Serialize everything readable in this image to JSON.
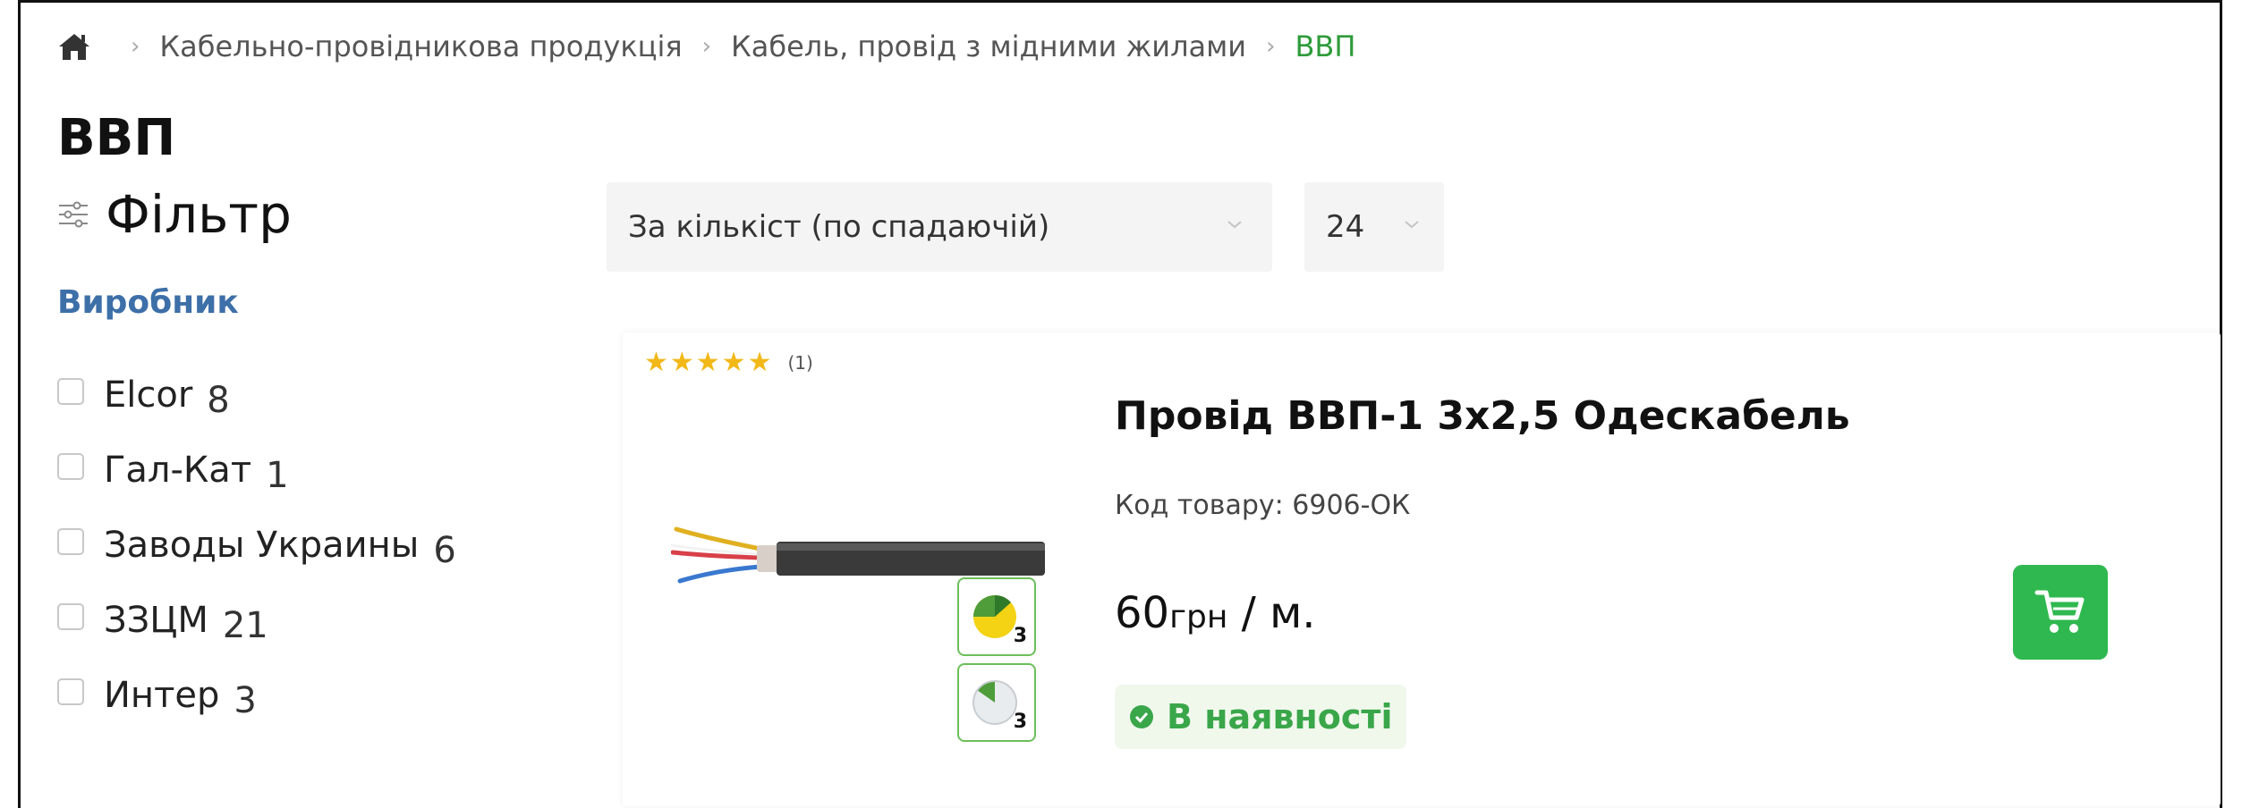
{
  "breadcrumb": {
    "items": [
      "Кабельно-провідникова продукція",
      "Кабель, провід з мідними жилами"
    ],
    "current": "ВВП",
    "separator": "›"
  },
  "page_title": "ВВП",
  "filter": {
    "title": "Фільтр",
    "section_title": "Виробник",
    "manufacturers": [
      {
        "name": "Elcor",
        "count": "8"
      },
      {
        "name": "Гал-Кат",
        "count": "1"
      },
      {
        "name": "Заводы Украины",
        "count": "6"
      },
      {
        "name": "ЗЗЦМ",
        "count": "21"
      },
      {
        "name": "Интер",
        "count": "3"
      }
    ]
  },
  "toolbar": {
    "sort_value": "За кількіст (по спадаючій)",
    "per_page_value": "24"
  },
  "product": {
    "stars": "★★★★★",
    "rating": 5,
    "reviews": "(1)",
    "name": "Провід ВВП-1 3х2,5 Одескабель",
    "sku": "Код товару: 6906-ОК",
    "price_value": "60",
    "price_unit": "грн",
    "price_per": " / м.",
    "stock": "В наявності",
    "badge_1_num": "3",
    "badge_2_num": "3"
  },
  "colors": {
    "accent_green": "#2fb84f",
    "stock_green": "#3aa64a",
    "breadcrumb_current": "#2e9b3a",
    "section_blue": "#3d6fa8",
    "star_yellow": "#f2b818"
  },
  "icons": [
    "home-icon",
    "filter-sliders-icon",
    "chevron-down-icon",
    "cart-icon",
    "check-circle-icon"
  ]
}
